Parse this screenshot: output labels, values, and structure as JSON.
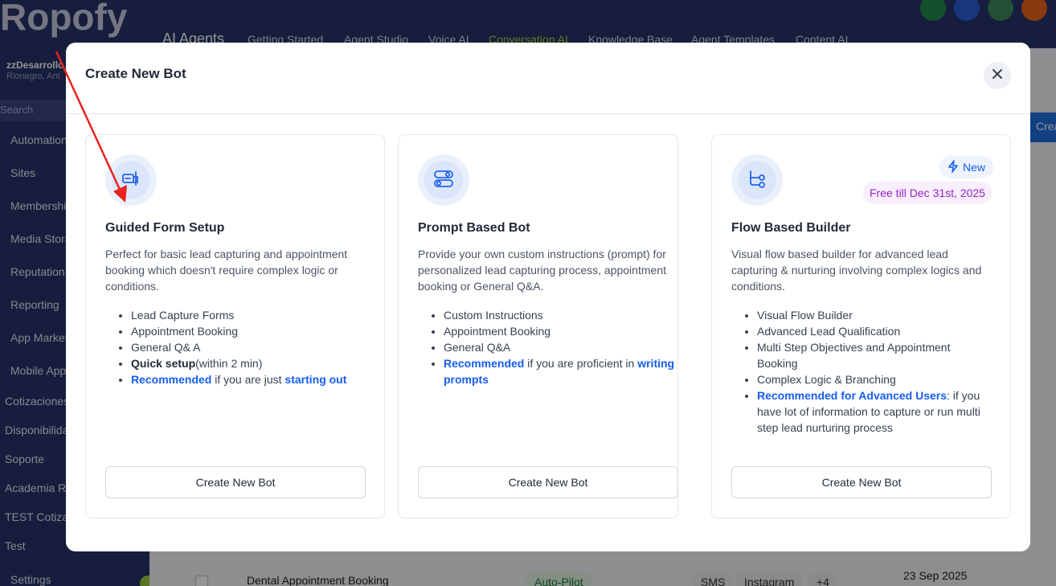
{
  "app": {
    "logo_text": "Ropofy",
    "account_name": "zzDesarrollo",
    "account_location": "Rionegro, Ant",
    "search_placeholder": "Search",
    "nav_items": [
      "Automation",
      "Sites",
      "Memberships",
      "Media Storage",
      "Reputation",
      "Reporting",
      "App Marketplace",
      "Mobile App"
    ],
    "sub_items": [
      "Cotizaciones",
      "Disponibilidad",
      "Soporte",
      "Academia R",
      "TEST Cotiza",
      "Test"
    ],
    "settings_label": "Settings",
    "section_title": "AI Agents",
    "top_tabs": [
      "Getting Started",
      "Agent Studio",
      "Voice AI",
      "Conversation AI",
      "Knowledge Base",
      "Agent Templates",
      "Content AI"
    ],
    "active_tab": "Conversation AI",
    "create_button_label": "Crea",
    "row": {
      "name": "Dental Appointment Booking",
      "mode": "Auto-Pilot",
      "channels": [
        "SMS",
        "Instagram",
        "+4"
      ],
      "date": "23 Sep 2025"
    },
    "colors": {
      "sidebar": "#283269",
      "accent_green": "#a6d13b",
      "primary": "#1f6fe0"
    }
  },
  "modal": {
    "title": "Create New Bot",
    "close_icon": "close-icon",
    "cards": [
      {
        "icon": "form-icon",
        "title": "Guided Form Setup",
        "description": "Perfect for basic lead capturing and appointment booking which doesn't require complex logic or conditions.",
        "features": [
          "Lead Capture Forms",
          "Appointment Booking",
          "General Q& A"
        ],
        "quick_setup_bold": "Quick setup",
        "quick_setup_rest": "(within 2 min)",
        "recommended_bold": "Recommended",
        "recommended_rest": " if you are just ",
        "recommended_tail": "starting out",
        "button": "Create New Bot"
      },
      {
        "icon": "toggles-icon",
        "title": "Prompt Based Bot",
        "description": "Provide your own custom instructions (prompt) for personalized lead capturing process, appointment booking or General Q&A.",
        "features": [
          "Custom Instructions",
          "Appointment Booking",
          "General Q&A"
        ],
        "recommended_bold": "Recommended",
        "recommended_rest": " if you are proficient in ",
        "recommended_tail": "writing prompts",
        "button": "Create New Bot"
      },
      {
        "icon": "flow-icon",
        "title": "Flow Based Builder",
        "badge_new": "New",
        "badge_free": "Free till Dec 31st, 2025",
        "description": "Visual flow based builder for advanced lead capturing & nurturing involving complex logics and conditions.",
        "features": [
          "Visual Flow Builder",
          "Advanced Lead Qualification",
          "Multi Step Objectives and Appointment Booking",
          "Complex Logic & Branching"
        ],
        "recommended_bold": "Recommended for Advanced Users",
        "recommended_rest": ": if you have lot of information to capture or run multi step lead nurturing process",
        "button": "Create New Bot"
      }
    ]
  }
}
